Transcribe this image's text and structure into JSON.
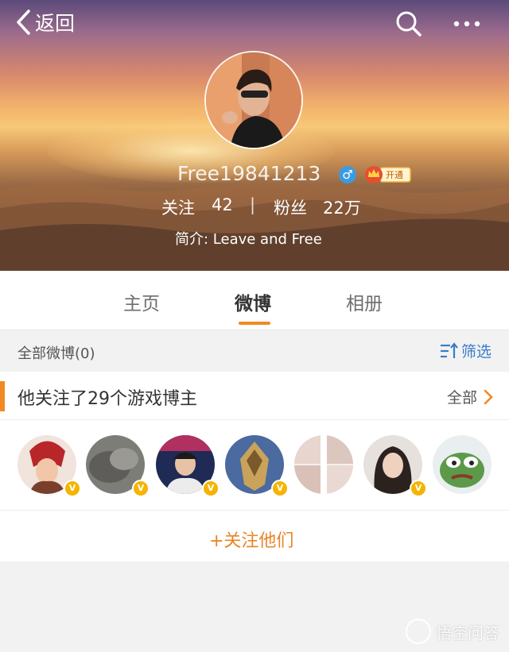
{
  "nav": {
    "back_label": "返回"
  },
  "profile": {
    "username": "Free19841213",
    "gender_symbol": "♂",
    "vip_badge": "开通",
    "following_label": "关注",
    "following_count": "42",
    "separator": "|",
    "followers_label": "粉丝",
    "followers_count": "22万",
    "bio": "简介: Leave and Free"
  },
  "tabs": [
    {
      "label": "主页"
    },
    {
      "label": "微博"
    },
    {
      "label": "相册"
    }
  ],
  "filter": {
    "title": "全部微博(0)",
    "button_label": "筛选"
  },
  "follow_card": {
    "title": "他关注了29个游戏博主",
    "all_label": "全部",
    "verified_badge": "V",
    "follow_all_label": "+关注他们"
  },
  "watermark": {
    "text": "悟空问答"
  }
}
